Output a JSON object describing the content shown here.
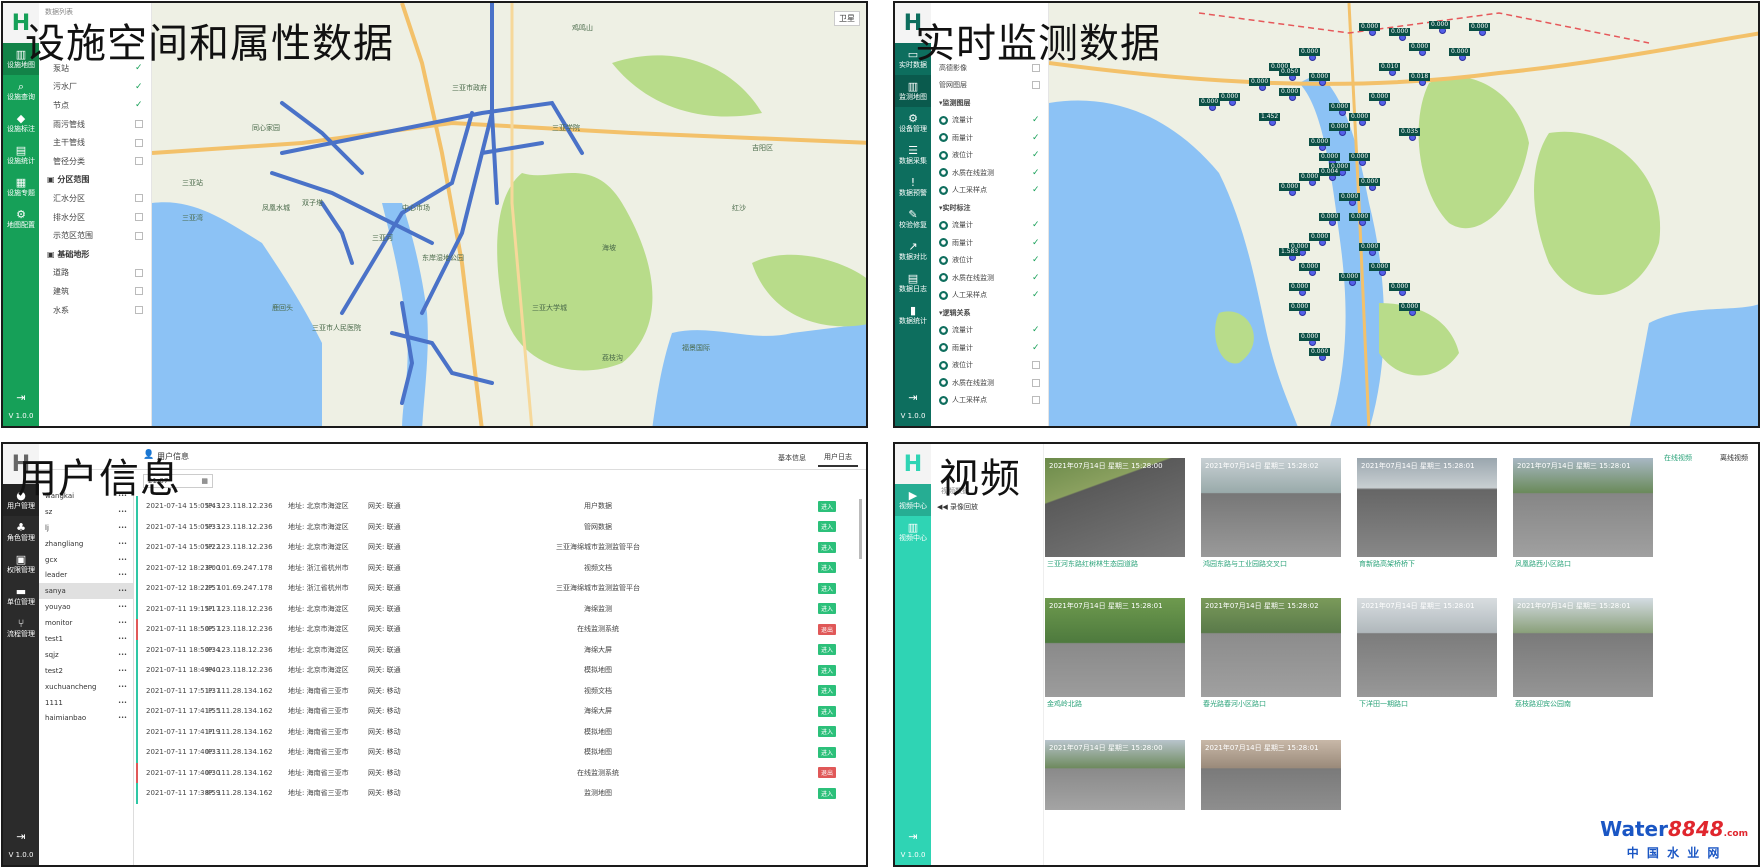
{
  "panels": {
    "p1": {
      "title": "设施空间和属性数据"
    },
    "p2": {
      "title": "实时监测数据"
    },
    "p3": {
      "title": "用户信息"
    },
    "p4": {
      "title": "视频"
    }
  },
  "p1": {
    "breadcrumb": "数据列表",
    "satellite": "卫星",
    "nav": [
      {
        "icon": "map-icon",
        "label": "设施地图"
      },
      {
        "icon": "search-icon",
        "label": "设施查询"
      },
      {
        "icon": "tag-icon",
        "label": "设施标注"
      },
      {
        "icon": "bars-icon",
        "label": "设施统计"
      },
      {
        "icon": "grid-icon",
        "label": "设施专题"
      },
      {
        "icon": "gear-icon",
        "label": "地图配置"
      }
    ],
    "version": "V 1.0.0",
    "layers": [
      {
        "label": "泵站",
        "checked": true,
        "group": false
      },
      {
        "label": "污水厂",
        "checked": true,
        "group": false
      },
      {
        "label": "节点",
        "checked": true,
        "group": false
      },
      {
        "label": "雨污管线",
        "checked": false,
        "group": false
      },
      {
        "label": "主干管线",
        "checked": false,
        "group": false
      },
      {
        "label": "管径分类",
        "checked": false,
        "group": false
      },
      {
        "label": "分区范围",
        "checked": null,
        "group": true
      },
      {
        "label": "汇水分区",
        "checked": false,
        "group": false
      },
      {
        "label": "排水分区",
        "checked": false,
        "group": false
      },
      {
        "label": "示范区范围",
        "checked": false,
        "group": false
      },
      {
        "label": "基础地形",
        "checked": null,
        "group": true
      },
      {
        "label": "道路",
        "checked": false,
        "group": false
      },
      {
        "label": "建筑",
        "checked": false,
        "group": false
      },
      {
        "label": "水系",
        "checked": false,
        "group": false
      }
    ],
    "map_labels": [
      "双子塔",
      "凤凰水城",
      "同心家园",
      "三亚湾",
      "鹿回头",
      "三亚市人民医院",
      "三亚学院",
      "三亚市政府",
      "鸡鸣山",
      "东岸湿地公园",
      "海坡",
      "三亚河",
      "红沙",
      "吉阳区",
      "三亚站",
      "中心市场",
      "荔枝沟",
      "福景国际",
      "三亚大学城"
    ]
  },
  "p2": {
    "nav": [
      {
        "icon": "screen-icon",
        "label": "实时数据"
      },
      {
        "icon": "map-icon",
        "label": "监测地图"
      },
      {
        "icon": "gear-icon",
        "label": "设备管理"
      },
      {
        "icon": "db-icon",
        "label": "数据采集"
      },
      {
        "icon": "alert-icon",
        "label": "数据预警"
      },
      {
        "icon": "wrench-icon",
        "label": "校验修复"
      },
      {
        "icon": "chart-icon",
        "label": "数据对比"
      },
      {
        "icon": "doc-icon",
        "label": "数据日志"
      },
      {
        "icon": "stat-icon",
        "label": "数据统计"
      }
    ],
    "version": "V 1.0.0",
    "layers": [
      {
        "label": "高德影像",
        "type": "item",
        "checked": false
      },
      {
        "label": "管网图层",
        "type": "item",
        "checked": false
      },
      {
        "label": "监测图层",
        "type": "group"
      },
      {
        "label": "流量计",
        "type": "dev",
        "checked": true
      },
      {
        "label": "雨量计",
        "type": "dev",
        "checked": true
      },
      {
        "label": "液位计",
        "type": "dev",
        "checked": true
      },
      {
        "label": "水质在线监测",
        "type": "dev",
        "checked": true
      },
      {
        "label": "人工采样点",
        "type": "dev",
        "checked": true
      },
      {
        "label": "实时标注",
        "type": "group"
      },
      {
        "label": "流量计",
        "type": "dev",
        "checked": true
      },
      {
        "label": "雨量计",
        "type": "dev",
        "checked": true
      },
      {
        "label": "液位计",
        "type": "dev",
        "checked": true
      },
      {
        "label": "水质在线监测",
        "type": "dev",
        "checked": true
      },
      {
        "label": "人工采样点",
        "type": "dev",
        "checked": true
      },
      {
        "label": "逻辑关系",
        "type": "group"
      },
      {
        "label": "流量计",
        "type": "dev",
        "checked": true
      },
      {
        "label": "雨量计",
        "type": "dev",
        "checked": true
      },
      {
        "label": "液位计",
        "type": "dev",
        "checked": false
      },
      {
        "label": "水质在线监测",
        "type": "dev",
        "checked": false
      },
      {
        "label": "人工采样点",
        "type": "dev",
        "checked": false
      }
    ],
    "markers": [
      "0.000",
      "0.000",
      "0.000",
      "0.000",
      "0.000",
      "0.000",
      "0.000",
      "0.000",
      "0.000",
      "0.000",
      "0.000",
      "0.000",
      "0.000",
      "0.000",
      "0.000",
      "0.000",
      "0.000",
      "0.000",
      "0.000",
      "0.000",
      "0.000",
      "0.000",
      "0.000",
      "0.000",
      "0.000",
      "0.000",
      "0.000",
      "0.000",
      "0.000",
      "0.000",
      "0.000",
      "0.000",
      "0.000",
      "0.000",
      "0.000",
      "0.000",
      "1.583",
      "1.452",
      "0.035",
      "0.004",
      "0.010",
      "0.018",
      "0.050",
      "0.000",
      "0.000",
      "0.000"
    ]
  },
  "p3": {
    "top_label": "用户信息",
    "tab_basic": "基本信息",
    "tab_log": "用户日志",
    "date": "21-07",
    "nav": [
      {
        "icon": "user-icon",
        "label": "用户管理"
      },
      {
        "icon": "role-icon",
        "label": "角色管理"
      },
      {
        "icon": "org-icon",
        "label": "权限管理"
      },
      {
        "icon": "unit-icon",
        "label": "单位管理"
      },
      {
        "icon": "flow-icon",
        "label": "流程管理"
      }
    ],
    "version": "V 1.0.0",
    "users": [
      "wangkai",
      "sz",
      "lj",
      "zhangliang",
      "gcx",
      "leader",
      "sanya",
      "youyao",
      "monitor",
      "test1",
      "sqjz",
      "test2",
      "xuchuancheng",
      "1111",
      "haimianbao"
    ],
    "selected_user": "sanya",
    "rows": [
      {
        "time": "2021-07-14 15:05:43",
        "ip": "IP: 123.118.12.236",
        "addr": "地址: 北京市海淀区",
        "net": "网关: 联通",
        "page": "用户数据",
        "tag": "进入",
        "red": false
      },
      {
        "time": "2021-07-14 15:05:33",
        "ip": "IP: 123.118.12.236",
        "addr": "地址: 北京市海淀区",
        "net": "网关: 联通",
        "page": "管网数据",
        "tag": "进入",
        "red": false
      },
      {
        "time": "2021-07-14 15:05:22",
        "ip": "IP: 123.118.12.236",
        "addr": "地址: 北京市海淀区",
        "net": "网关: 联通",
        "page": "三亚海绵城市监测监管平台",
        "tag": "进入",
        "red": false
      },
      {
        "time": "2021-07-12 18:23:00",
        "ip": "IP: 101.69.247.178",
        "addr": "地址: 浙江省杭州市",
        "net": "网关: 联通",
        "page": "视频文档",
        "tag": "进入",
        "red": false
      },
      {
        "time": "2021-07-12 18:22:57",
        "ip": "IP: 101.69.247.178",
        "addr": "地址: 浙江省杭州市",
        "net": "网关: 联通",
        "page": "三亚海绵城市监测监管平台",
        "tag": "进入",
        "red": false
      },
      {
        "time": "2021-07-11 19:15:17",
        "ip": "IP: 123.118.12.236",
        "addr": "地址: 北京市海淀区",
        "net": "网关: 联通",
        "page": "海绵监测",
        "tag": "进入",
        "red": false
      },
      {
        "time": "2021-07-11 18:50:57",
        "ip": "IP: 123.118.12.236",
        "addr": "地址: 北京市海淀区",
        "net": "网关: 联通",
        "page": "在线监测系统",
        "tag": "退出",
        "red": true
      },
      {
        "time": "2021-07-11 18:50:34",
        "ip": "IP: 123.118.12.236",
        "addr": "地址: 北京市海淀区",
        "net": "网关: 联通",
        "page": "海绵大屏",
        "tag": "进入",
        "red": false
      },
      {
        "time": "2021-07-11 18:49:40",
        "ip": "IP: 123.118.12.236",
        "addr": "地址: 北京市海淀区",
        "net": "网关: 联通",
        "page": "模拟地图",
        "tag": "进入",
        "red": false
      },
      {
        "time": "2021-07-11 17:51:37",
        "ip": "IP: 111.28.134.162",
        "addr": "地址: 海南省三亚市",
        "net": "网关: 移动",
        "page": "视频文档",
        "tag": "进入",
        "red": false
      },
      {
        "time": "2021-07-11 17:41:55",
        "ip": "IP: 111.28.134.162",
        "addr": "地址: 海南省三亚市",
        "net": "网关: 移动",
        "page": "海绵大屏",
        "tag": "进入",
        "red": false
      },
      {
        "time": "2021-07-11 17:41:19",
        "ip": "IP: 111.28.134.162",
        "addr": "地址: 海南省三亚市",
        "net": "网关: 移动",
        "page": "模拟地图",
        "tag": "进入",
        "red": false
      },
      {
        "time": "2021-07-11 17:40:33",
        "ip": "IP: 111.28.134.162",
        "addr": "地址: 海南省三亚市",
        "net": "网关: 移动",
        "page": "模拟地图",
        "tag": "进入",
        "red": false
      },
      {
        "time": "2021-07-11 17:40:30",
        "ip": "IP: 111.28.134.162",
        "addr": "地址: 海南省三亚市",
        "net": "网关: 移动",
        "page": "在线监测系统",
        "tag": "退出",
        "red": true
      },
      {
        "time": "2021-07-11 17:38:59",
        "ip": "IP: 111.28.134.162",
        "addr": "地址: 海南省三亚市",
        "net": "网关: 移动",
        "page": "监测地图",
        "tag": "进入",
        "red": false
      }
    ]
  },
  "p4": {
    "tab_online": "在线视频",
    "tab_offline": "离线视频",
    "playback": "录像回放",
    "tree_root": "视频数据",
    "nav": [
      {
        "icon": "video-icon",
        "label": "视频中心"
      },
      {
        "icon": "map-icon",
        "label": "视频中心"
      }
    ],
    "version": "V 1.0.0",
    "videos": [
      {
        "ts": "2021年07月14日 星期三 15:28:00",
        "cap": "三亚河东路红树林生态园道路",
        "scene": "road"
      },
      {
        "ts": "2021年07月14日 星期三 15:28:02",
        "cap": "鸿园东路与工业园路交叉口",
        "scene": "street"
      },
      {
        "ts": "2021年07月14日 星期三 15:28:01",
        "cap": "育新路高架桥桥下",
        "scene": "tunnel"
      },
      {
        "ts": "2021年07月14日 星期三 15:28:01",
        "cap": "凤凰路西小区路口",
        "scene": "road2"
      },
      {
        "ts": "2021年07月14日 星期三 15:28:01",
        "cap": "金鸡岭北路",
        "scene": "trees"
      },
      {
        "ts": "2021年07月14日 星期三 15:28:02",
        "cap": "春光路春河小区路口",
        "scene": "street2"
      },
      {
        "ts": "2021年07月14日 星期三 15:28:01",
        "cap": "下洋田一期路口",
        "scene": "junction"
      },
      {
        "ts": "2021年07月14日 星期三 15:28:01",
        "cap": "荔枝路迎宾公园南",
        "scene": "avenue"
      },
      {
        "ts": "2021年07月14日 星期三 15:28:00",
        "cap": "",
        "scene": "crossing"
      },
      {
        "ts": "2021年07月14日 星期三 15:28:01",
        "cap": "",
        "scene": "market"
      }
    ],
    "watermark_main": "Water",
    "watermark_num": "8848",
    "watermark_com": ".com",
    "watermark_cn": "中 国 水 业 网"
  },
  "colors": {
    "green_nav": "#16a058",
    "teal_nav": "#0d6e5e",
    "mint_nav": "#2fd4b4",
    "dark_nav": "#2b2b2b",
    "water": "#8cc2f5",
    "land": "#eef0e4",
    "pipe": "#4a72c8",
    "park": "#b8dc8a"
  }
}
